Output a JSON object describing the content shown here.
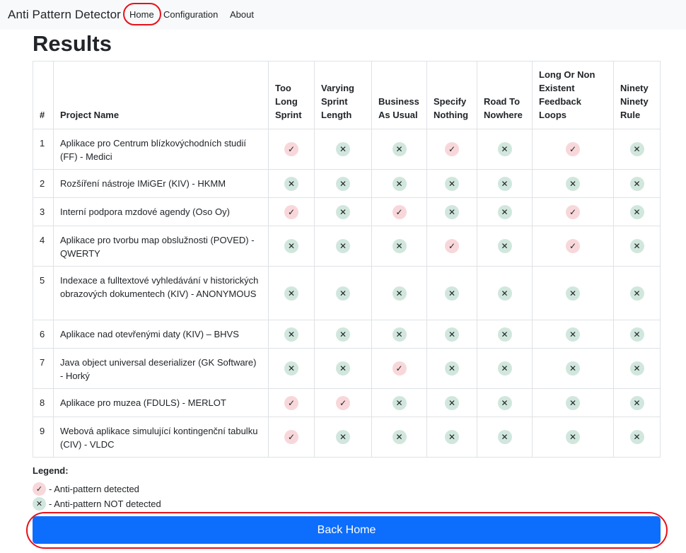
{
  "nav": {
    "brand": "Anti Pattern Detector",
    "links": [
      "Home",
      "Configuration",
      "About"
    ]
  },
  "page": {
    "title": "Results"
  },
  "table": {
    "headers": [
      "#",
      "Project Name",
      "Too Long Sprint",
      "Varying Sprint Length",
      "Business As Usual",
      "Specify Nothing",
      "Road To Nowhere",
      "Long Or Non Existent Feedback Loops",
      "Ninety Ninety Rule"
    ],
    "rows": [
      {
        "num": "1",
        "name": "Aplikace pro Centrum blízkovýchodních studií (FF) - Medici",
        "marks": [
          true,
          false,
          false,
          true,
          false,
          true,
          false
        ]
      },
      {
        "num": "2",
        "name": "Rozšíření nástroje IMiGEr (KIV) - HKMM",
        "marks": [
          false,
          false,
          false,
          false,
          false,
          false,
          false
        ]
      },
      {
        "num": "3",
        "name": "Interní podpora mzdové agendy (Oso Oy)",
        "marks": [
          true,
          false,
          true,
          false,
          false,
          true,
          false
        ]
      },
      {
        "num": "4",
        "name": "Aplikace pro tvorbu map obslužnosti (POVED) - QWERTY",
        "marks": [
          false,
          false,
          false,
          true,
          false,
          true,
          false
        ]
      },
      {
        "num": "5",
        "name": "Indexace a fulltextové vyhledávání v historických obrazových dokumentech (KIV) - ANONYMOUS",
        "marks": [
          false,
          false,
          false,
          false,
          false,
          false,
          false
        ]
      },
      {
        "num": "6",
        "name": "Aplikace nad otevřenými daty (KIV) – BHVS",
        "marks": [
          false,
          false,
          false,
          false,
          false,
          false,
          false
        ]
      },
      {
        "num": "7",
        "name": "Java object universal deserializer (GK Software) - Horký",
        "marks": [
          false,
          false,
          true,
          false,
          false,
          false,
          false
        ]
      },
      {
        "num": "8",
        "name": "Aplikace pro muzea (FDULS) - MERLOT",
        "marks": [
          true,
          true,
          false,
          false,
          false,
          false,
          false
        ]
      },
      {
        "num": "9",
        "name": "Webová aplikace simulující kontingenční tabulku (CIV) - VLDC",
        "marks": [
          true,
          false,
          false,
          false,
          false,
          false,
          false
        ]
      }
    ]
  },
  "legend": {
    "title": "Legend:",
    "detected": "- Anti-pattern detected",
    "not_detected": "- Anti-pattern NOT detected"
  },
  "icons": {
    "detected_icon": "check-mark-icon",
    "not_detected_icon": "x-mark-icon",
    "detected_glyph": "✓",
    "not_detected_glyph": "✕"
  },
  "colors": {
    "detected_bg": "#f8d7da",
    "not_detected_bg": "#d1e7dd",
    "primary": "#0d6efd",
    "highlight": "#e8101a"
  },
  "actions": {
    "back_home": "Back Home"
  }
}
